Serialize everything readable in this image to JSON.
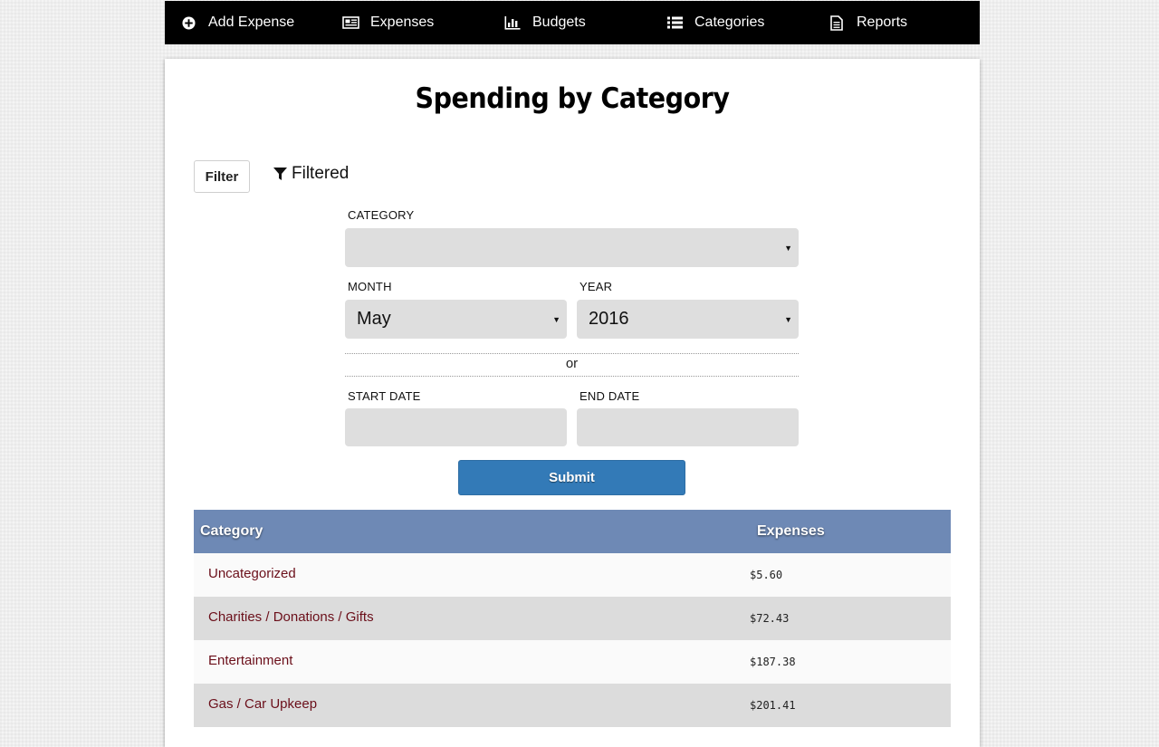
{
  "nav": {
    "items": [
      {
        "label": "Add Expense",
        "icon": "plus-circle-icon"
      },
      {
        "label": "Expenses",
        "icon": "newspaper-icon"
      },
      {
        "label": "Budgets",
        "icon": "bar-chart-icon"
      },
      {
        "label": "Categories",
        "icon": "list-icon"
      },
      {
        "label": "Reports",
        "icon": "file-text-icon"
      }
    ]
  },
  "page": {
    "title": "Spending by Category"
  },
  "filter": {
    "button_label": "Filter",
    "status_label": "Filtered",
    "category_label": "CATEGORY",
    "category_value": "",
    "month_label": "MONTH",
    "month_value": "May",
    "year_label": "YEAR",
    "year_value": "2016",
    "or_label": "or",
    "start_date_label": "START DATE",
    "start_date_value": "",
    "end_date_label": "END DATE",
    "end_date_value": "",
    "submit_label": "Submit"
  },
  "table": {
    "headers": [
      "Category",
      "Expenses"
    ],
    "rows": [
      {
        "category": "Uncategorized",
        "amount": "$5.60"
      },
      {
        "category": "Charities / Donations / Gifts",
        "amount": "$72.43"
      },
      {
        "category": "Entertainment",
        "amount": "$187.38"
      },
      {
        "category": "Gas / Car Upkeep",
        "amount": "$201.41"
      }
    ]
  },
  "colors": {
    "navbar": "#000000",
    "table_header": "#6e89b5",
    "submit": "#337ab7",
    "link": "#6b0f1a"
  }
}
